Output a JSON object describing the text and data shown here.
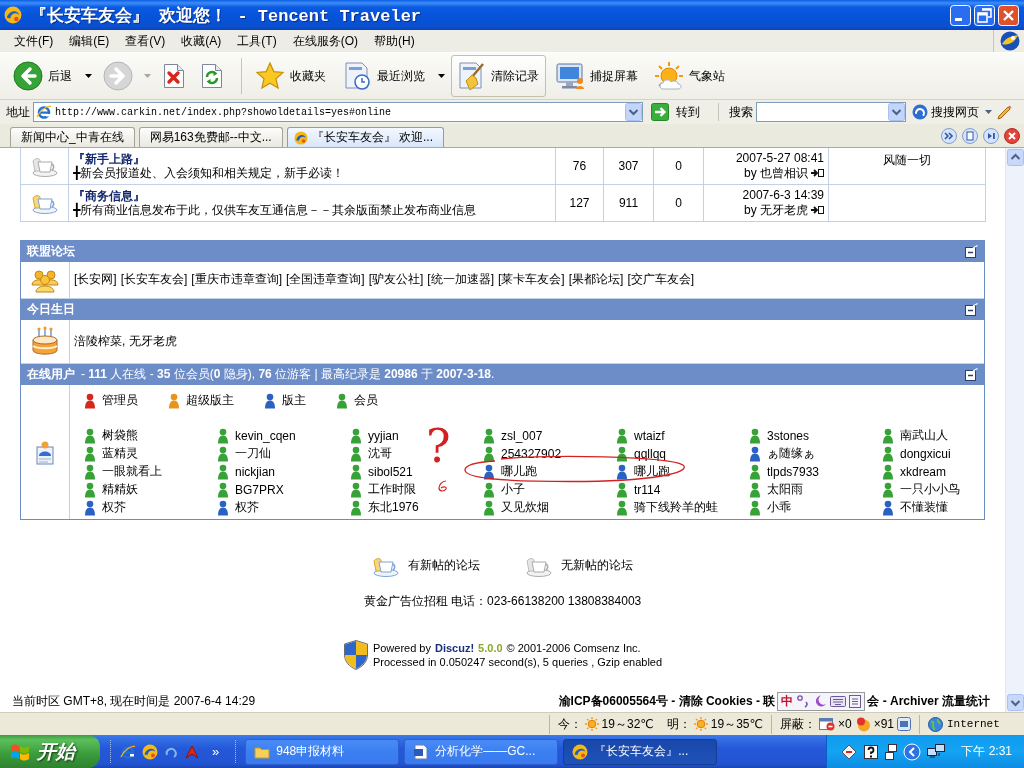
{
  "window": {
    "title": "『长安车友会』 欢迎您！ - Tencent Traveler"
  },
  "menu": [
    {
      "label": "文件(F)"
    },
    {
      "label": "编辑(E)"
    },
    {
      "label": "查看(V)"
    },
    {
      "label": "收藏(A)"
    },
    {
      "label": "工具(T)"
    },
    {
      "label": "在线服务(O)"
    },
    {
      "label": "帮助(H)"
    }
  ],
  "toolbar": [
    {
      "kind": "back",
      "label": "后退",
      "dropdown": true,
      "disabled": false,
      "pressed": false
    },
    {
      "kind": "forward",
      "dropdown": true,
      "disabled": true,
      "pressed": false
    },
    {
      "kind": "stop",
      "dropdown": false,
      "disabled": false,
      "pressed": false
    },
    {
      "kind": "refresh",
      "dropdown": false,
      "disabled": false,
      "pressed": false
    },
    {
      "kind": "favorites",
      "label": "收藏夹",
      "dropdown": false,
      "disabled": false,
      "pressed": false
    },
    {
      "kind": "history",
      "label": "最近浏览",
      "dropdown": true,
      "disabled": false,
      "pressed": false
    },
    {
      "kind": "clear",
      "label": "清除记录",
      "dropdown": false,
      "disabled": false,
      "pressed": true
    },
    {
      "kind": "capture",
      "label": "捕捉屏幕",
      "dropdown": false,
      "disabled": false,
      "pressed": false
    },
    {
      "kind": "weather",
      "label": "气象站",
      "dropdown": false,
      "disabled": false,
      "pressed": false
    }
  ],
  "address_bar": {
    "label": "地址",
    "url": "http://www.carkin.net/index.php?showoldetails=yes#online",
    "go": "转到",
    "search_label": "搜索",
    "search_engine": "搜搜网页"
  },
  "tabs": [
    {
      "label": "新闻中心_中青在线",
      "selected": false
    },
    {
      "label": "网易163免费邮--中文...",
      "selected": false
    },
    {
      "label": "『长安车友会』 欢迎...",
      "selected": true
    }
  ],
  "forums": [
    {
      "name": "『新手上路』",
      "description": "╋新会员报道处、入会须知和相关规定，新手必读！",
      "topics": "76",
      "posts": "307",
      "today": "0",
      "last_post_time": "2007-5-27 08:41",
      "last_post_by": "by 也曾相识",
      "moderator": "风随一切",
      "new_posts": false
    },
    {
      "name": "『商务信息』",
      "description": "╋所有商业信息发布于此，仅供车友互通信息－－其余版面禁止发布商业信息",
      "topics": "127",
      "posts": "911",
      "today": "0",
      "last_post_time": "2007-6-3 14:39",
      "last_post_by": "by 无牙老虎",
      "new_posts": true
    }
  ],
  "alliance": {
    "title": "联盟论坛",
    "links": [
      "[长安网]",
      "[长安车友会]",
      "[重庆市违章查询]",
      "[全国违章查询]",
      "[驴友公社]",
      "[统一加速器]",
      "[莱卡车友会]",
      "[果都论坛]",
      "[交广车友会]"
    ]
  },
  "birthdays": {
    "title": "今日生日",
    "people": "涪陵榨菜, 无牙老虎"
  },
  "online": {
    "title": "在线用户",
    "summary": "- **111** 人在线 - **35** 位会员(**0** 隐身), **76** 位游客 | 最高纪录是 **20986** 于 **2007-3-18**.",
    "legend": [
      {
        "color": "#d42a1e",
        "label": "管理员"
      },
      {
        "color": "#e8941a",
        "label": "超级版主"
      },
      {
        "color": "#2a62c4",
        "label": "版主"
      },
      {
        "color": "#37a237",
        "label": "会员"
      }
    ],
    "users": [
      {
        "name": "树袋熊",
        "color": "#37a237"
      },
      {
        "name": "kevin_cqen",
        "color": "#37a237"
      },
      {
        "name": "yyjian",
        "color": "#37a237"
      },
      {
        "name": "zsl_007",
        "color": "#37a237"
      },
      {
        "name": "wtaizf",
        "color": "#37a237"
      },
      {
        "name": "3stones",
        "color": "#37a237"
      },
      {
        "name": "南武山人",
        "color": "#37a237"
      },
      {
        "name": "蓝精灵",
        "color": "#37a237"
      },
      {
        "name": "一刀仙",
        "color": "#37a237"
      },
      {
        "name": "沈哥",
        "color": "#37a237"
      },
      {
        "name": "254327902",
        "color": "#37a237"
      },
      {
        "name": "qqllqq",
        "color": "#37a237"
      },
      {
        "name": "ぁ随缘ぁ",
        "color": "#2a62c4"
      },
      {
        "name": "dongxicui",
        "color": "#37a237"
      },
      {
        "name": "一眼就看上",
        "color": "#37a237"
      },
      {
        "name": "nickjian",
        "color": "#37a237"
      },
      {
        "name": "sibol521",
        "color": "#37a237"
      },
      {
        "name": "哪儿跑",
        "color": "#2a62c4"
      },
      {
        "name": "哪儿跑",
        "color": "#2a62c4"
      },
      {
        "name": "tlpds7933",
        "color": "#37a237"
      },
      {
        "name": "xkdream",
        "color": "#37a237"
      },
      {
        "name": "精精妖",
        "color": "#37a237"
      },
      {
        "name": "BG7PRX",
        "color": "#37a237"
      },
      {
        "name": "工作时限",
        "color": "#37a237"
      },
      {
        "name": "小子",
        "color": "#37a237"
      },
      {
        "name": "tr114",
        "color": "#37a237"
      },
      {
        "name": "太阳雨",
        "color": "#37a237"
      },
      {
        "name": "一只小小鸟",
        "color": "#37a237"
      },
      {
        "name": "权芥",
        "color": "#2a62c4"
      },
      {
        "name": "权芥",
        "color": "#2a62c4"
      },
      {
        "name": "东北1976",
        "color": "#37a237"
      },
      {
        "name": "又见炊烟",
        "color": "#37a237"
      },
      {
        "name": "骑下线羚羊的蛙",
        "color": "#37a237"
      },
      {
        "name": "小乖",
        "color": "#37a237"
      },
      {
        "name": "不懂装懂",
        "color": "#2a62c4"
      }
    ],
    "annotation": {
      "question_mark": "?"
    }
  },
  "footer": {
    "legend": [
      {
        "new_posts": true,
        "label": "有新帖的论坛"
      },
      {
        "new_posts": false,
        "label": "无新帖的论坛"
      }
    ],
    "ad": "黄金广告位招租 电话：023-66138200 13808384003",
    "powered_by": "Powered by",
    "product": "Discuz!",
    "version": "5.0.0",
    "copyright": "© 2001-2006 Comsenz Inc.",
    "processed": "Processed in 0.050247 second(s), 5 queries , Gzip enabled"
  },
  "page_footer": {
    "time": "当前时区 GMT+8, 现在时间是 2007-6-4 14:29",
    "links_before": "渝ICP备06005564号 - 清除 Cookies - 联",
    "links_after": "会 - Archiver 流量统计"
  },
  "ime": {
    "mode": "中"
  },
  "status_bar": {
    "today_label": "今：",
    "today_temp": "19～32℃",
    "tomorrow_label": "明：",
    "tomorrow_temp": "19～35℃",
    "block_label": "屏蔽：",
    "popups": "×0",
    "ads": "×91",
    "zone": "Internet"
  },
  "taskbar": {
    "start": "开始",
    "more": "»",
    "tasks": [
      {
        "kind": "folder",
        "label": "948申报材料",
        "selected": false
      },
      {
        "kind": "document",
        "label": "分析化学——GC...",
        "selected": false
      },
      {
        "kind": "browser",
        "label": "『长安车友会』...",
        "selected": true
      }
    ],
    "clock": "下午 2:31"
  }
}
